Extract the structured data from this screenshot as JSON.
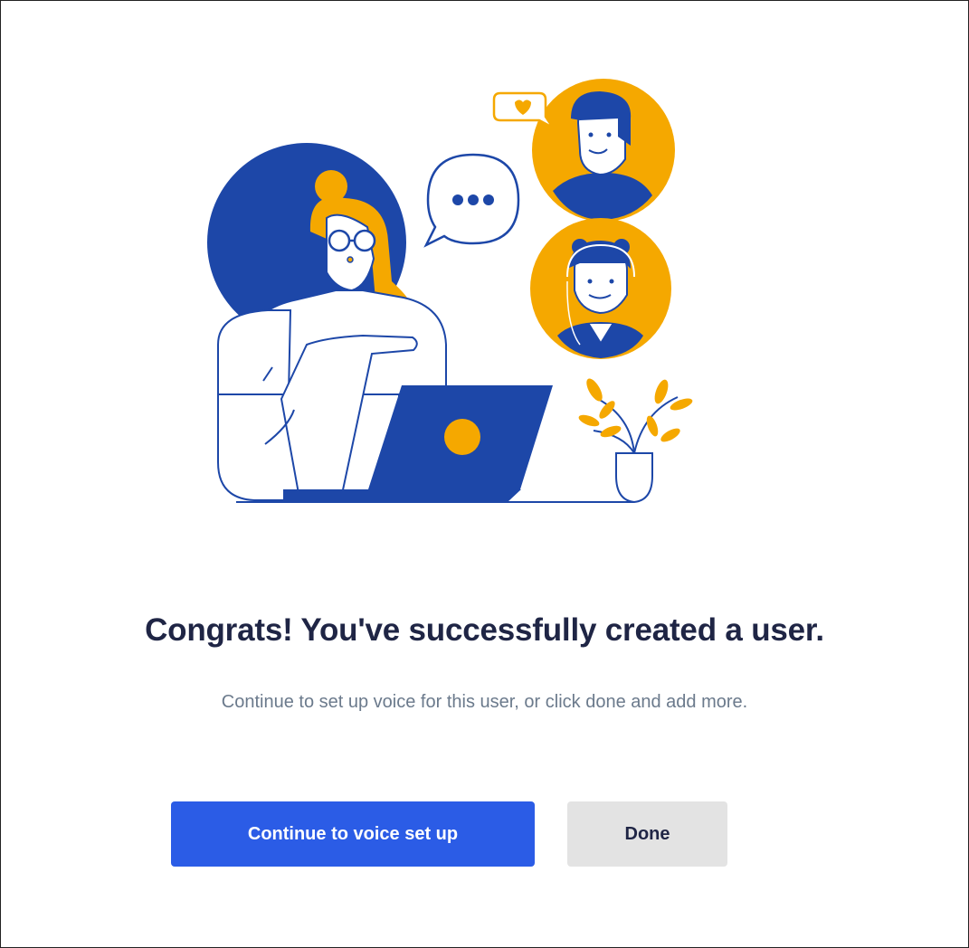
{
  "dialog": {
    "title": "Congrats! You've successfully created a user.",
    "subtitle": "Continue to set up voice for this user, or click done and add more.",
    "primary_button_label": "Continue to voice set up",
    "secondary_button_label": "Done"
  },
  "colors": {
    "primary": "#2b5ce6",
    "illustration_blue": "#1d47a8",
    "illustration_orange": "#f5a800",
    "title_text": "#1f2545",
    "subtitle_text": "#6b7a8c",
    "secondary_button_bg": "#e3e3e3"
  },
  "icons": [
    "video-call-illustration",
    "chat-bubble-icon",
    "heart-icon",
    "plant-icon",
    "laptop-icon"
  ]
}
